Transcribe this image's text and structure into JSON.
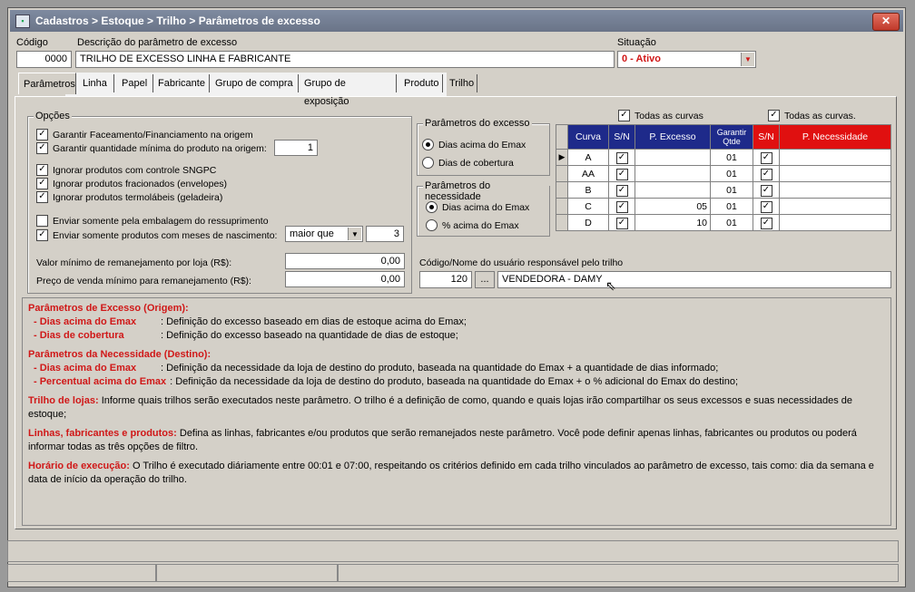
{
  "title": "Cadastros > Estoque > Trilho > Parâmetros de excesso",
  "header": {
    "codigo_label": "Código",
    "codigo_value": "0000",
    "descricao_label": "Descrição do parâmetro de excesso",
    "descricao_value": "TRILHO DE EXCESSO LINHA E FABRICANTE",
    "situacao_label": "Situação",
    "situacao_value": "0 - Ativo"
  },
  "tabs": [
    "Parâmetros",
    "Linha",
    "Papel",
    "Fabricante",
    "Grupo de compra",
    "Grupo de exposição",
    "Produto",
    "Trilho"
  ],
  "opcoes": {
    "title": "Opções",
    "items": [
      "Garantir Faceamento/Financiamento na origem",
      "Garantir quantidade mínima do produto na origem:",
      "Ignorar produtos com controle SNGPC",
      "Ignorar produtos fracionados (envelopes)",
      "Ignorar produtos termolábeis (geladeira)",
      "Enviar somente pela embalagem do ressuprimento",
      "Enviar somente produtos com meses de nascimento:"
    ],
    "qtd_minima": "1",
    "meses_op": "maior que",
    "meses_value": "3",
    "valor_label": "Valor mínimo de remanejamento por loja (R$):",
    "valor_value": "0,00",
    "preco_label": "Preço de venda mínimo para remanejamento (R$):",
    "preco_value": "0,00"
  },
  "excesso": {
    "title": "Parâmetros do excesso",
    "opt1": "Dias acima do Emax",
    "opt2": "Dias de cobertura"
  },
  "necessidade": {
    "title": "Parâmetros do necessidade",
    "opt1": "Dias acima do Emax",
    "opt2": "% acima do Emax"
  },
  "grid": {
    "todas1": "Todas as curvas",
    "todas2": "Todas as curvas.",
    "headers": [
      "Curva",
      "S/N",
      "P. Excesso",
      "Garantir Qtde",
      "S/N",
      "P. Necessidade"
    ],
    "rows": [
      {
        "curva": "A",
        "excesso": "",
        "qtde": "01"
      },
      {
        "curva": "AA",
        "excesso": "",
        "qtde": "01"
      },
      {
        "curva": "B",
        "excesso": "",
        "qtde": "01"
      },
      {
        "curva": "C",
        "excesso": "05",
        "qtde": "01"
      },
      {
        "curva": "D",
        "excesso": "10",
        "qtde": "01"
      }
    ]
  },
  "usuario": {
    "label": "Código/Nome do usuário responsável pelo trilho",
    "codigo": "120",
    "button": "...",
    "nome": "VENDEDORA - DAMY"
  },
  "help": {
    "h1": "Parâmetros de Excesso (Origem):",
    "h1a_term": "- Dias acima do Emax",
    "h1a_desc": ": Definição do excesso baseado em dias de estoque acima do Emax;",
    "h1b_term": "- Dias de cobertura",
    "h1b_desc": ": Definição do excesso baseado na quantidade de dias de estoque;",
    "h2": "Parâmetros da Necessidade (Destino):",
    "h2a_term": "- Dias acima do Emax",
    "h2a_desc": ": Definição da necessidade da loja de destino do produto, baseada na quantidade do Emax + a quantidade de dias informado;",
    "h2b_term": "- Percentual acima do Emax",
    "h2b_desc": ": Definição da necessidade da loja de destino do produto, baseada na quantidade do Emax + o % adicional do Emax do destino;",
    "h3": "Trilho de lojas:",
    "h3_desc": "Informe quais trilhos serão executados neste parâmetro. O trilho é a definição de como, quando e quais lojas irão compartilhar os seus excessos e suas necessidades de estoque;",
    "h4": "Linhas, fabricantes e produtos:",
    "h4_desc": "Defina as linhas, fabricantes e/ou produtos que serão remanejados neste parâmetro. Você pode definir apenas linhas, fabricantes ou produtos ou poderá informar todas as três opções de filtro.",
    "h5": "Horário de execução:",
    "h5_desc": "O Trilho é executado diáriamente entre 00:01 e 07:00, respeitando os critérios definido em cada trilho vinculados ao parâmetro de excesso, tais como: dia da semana e data de início da operação do trilho."
  }
}
